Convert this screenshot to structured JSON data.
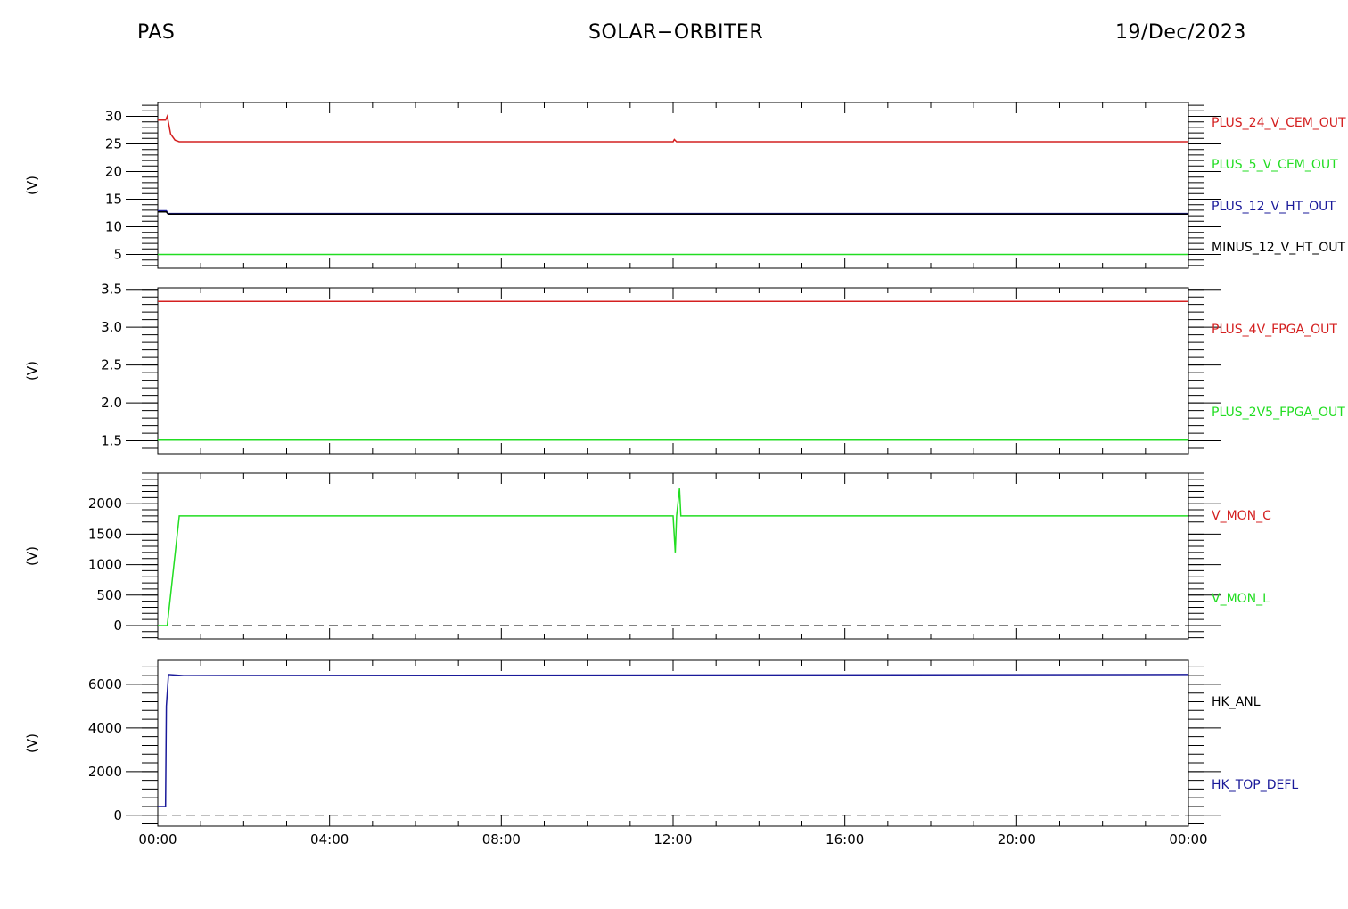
{
  "header": {
    "left": "PAS",
    "center": "SOLAR−ORBITER",
    "right": "19/Dec/2023"
  },
  "colors": {
    "red": "#d42020",
    "green": "#22dd22",
    "blue": "#1a1a9a",
    "black": "#000000"
  },
  "chart_data": [
    {
      "type": "line",
      "ylabel": "(V)",
      "ylim": [
        2.5,
        32.5
      ],
      "yticks": [
        5,
        10,
        15,
        20,
        25,
        30
      ],
      "ytick_labels": [
        "5",
        "10",
        "15",
        "20",
        "25",
        "30"
      ],
      "yminor": 1,
      "x_unit": "hours",
      "xlim": [
        0,
        24
      ],
      "series": [
        {
          "name": "PLUS_24_V_CEM_OUT",
          "color": "#d42020",
          "x": [
            0,
            0.18,
            0.22,
            0.3,
            0.4,
            0.5,
            12.0,
            12.03,
            12.08,
            24
          ],
          "y": [
            29.3,
            29.3,
            30.0,
            26.8,
            25.7,
            25.4,
            25.4,
            25.8,
            25.4,
            25.4
          ]
        },
        {
          "name": "PLUS_5_V_CEM_OUT",
          "color": "#22dd22",
          "x": [
            0,
            24
          ],
          "y": [
            5.0,
            5.0
          ]
        },
        {
          "name": "PLUS_12_V_HT_OUT",
          "color": "#1a1a9a",
          "x": [
            0,
            0.2,
            0.24,
            24
          ],
          "y": [
            12.9,
            12.9,
            12.4,
            12.4
          ]
        },
        {
          "name": "MINUS_12_V_HT_OUT",
          "color": "#000000",
          "x": [
            0,
            0.2,
            0.24,
            24
          ],
          "y": [
            12.7,
            12.7,
            12.3,
            12.3
          ]
        }
      ],
      "legend": [
        "PLUS_24_V_CEM_OUT",
        "PLUS_5_V_CEM_OUT",
        "PLUS_12_V_HT_OUT",
        "MINUS_12_V_HT_OUT"
      ]
    },
    {
      "type": "line",
      "ylabel": "(V)",
      "ylim": [
        1.33,
        3.52
      ],
      "yticks": [
        1.5,
        2.0,
        2.5,
        3.0,
        3.5
      ],
      "ytick_labels": [
        "1.5",
        "2.0",
        "2.5",
        "3.0",
        "3.5"
      ],
      "yminor": 0.1,
      "x_unit": "hours",
      "xlim": [
        0,
        24
      ],
      "series": [
        {
          "name": "PLUS_4V_FPGA_OUT",
          "color": "#d42020",
          "x": [
            0,
            24
          ],
          "y": [
            3.34,
            3.34
          ]
        },
        {
          "name": "PLUS_2V5_FPGA_OUT",
          "color": "#22dd22",
          "x": [
            0,
            24
          ],
          "y": [
            1.51,
            1.51
          ]
        }
      ],
      "legend": [
        "PLUS_4V_FPGA_OUT",
        "PLUS_2V5_FPGA_OUT"
      ]
    },
    {
      "type": "line",
      "ylabel": "(V)",
      "ylim": [
        -220,
        2500
      ],
      "yticks": [
        0,
        500,
        1000,
        1500,
        2000
      ],
      "ytick_labels": [
        "0",
        "500",
        "1000",
        "1500",
        "2000"
      ],
      "yminor": 100,
      "zero_line": true,
      "x_unit": "hours",
      "xlim": [
        0,
        24
      ],
      "series": [
        {
          "name": "V_MON_C",
          "color": "#d42020",
          "x": [],
          "y": []
        },
        {
          "name": "V_MON_L",
          "color": "#22dd22",
          "x": [
            0,
            0.22,
            0.5,
            12.0,
            12.05,
            12.08,
            12.15,
            12.18,
            24
          ],
          "y": [
            0,
            0,
            1800,
            1800,
            1200,
            1800,
            2250,
            1800,
            1800
          ]
        }
      ],
      "legend": [
        "V_MON_C",
        "V_MON_L"
      ]
    },
    {
      "type": "line",
      "ylabel": "(V)",
      "ylim": [
        -500,
        7100
      ],
      "yticks": [
        0,
        2000,
        4000,
        6000
      ],
      "ytick_labels": [
        "0",
        "2000",
        "4000",
        "6000"
      ],
      "yminor": 400,
      "zero_line": true,
      "x_unit": "hours",
      "xlim": [
        0,
        24
      ],
      "x_ticks": [
        0,
        4,
        8,
        12,
        16,
        20,
        24
      ],
      "x_tick_labels": [
        "00:00",
        "04:00",
        "08:00",
        "12:00",
        "16:00",
        "20:00",
        "00:00"
      ],
      "series": [
        {
          "name": "HK_ANL",
          "color": "#000000",
          "x": [],
          "y": []
        },
        {
          "name": "HK_TOP_DEFL",
          "color": "#1a1a9a",
          "x": [
            0,
            0.18,
            0.2,
            0.25,
            0.6,
            24
          ],
          "y": [
            400,
            400,
            5000,
            6450,
            6400,
            6450
          ]
        }
      ],
      "legend": [
        "HK_ANL",
        "HK_TOP_DEFL"
      ]
    }
  ]
}
